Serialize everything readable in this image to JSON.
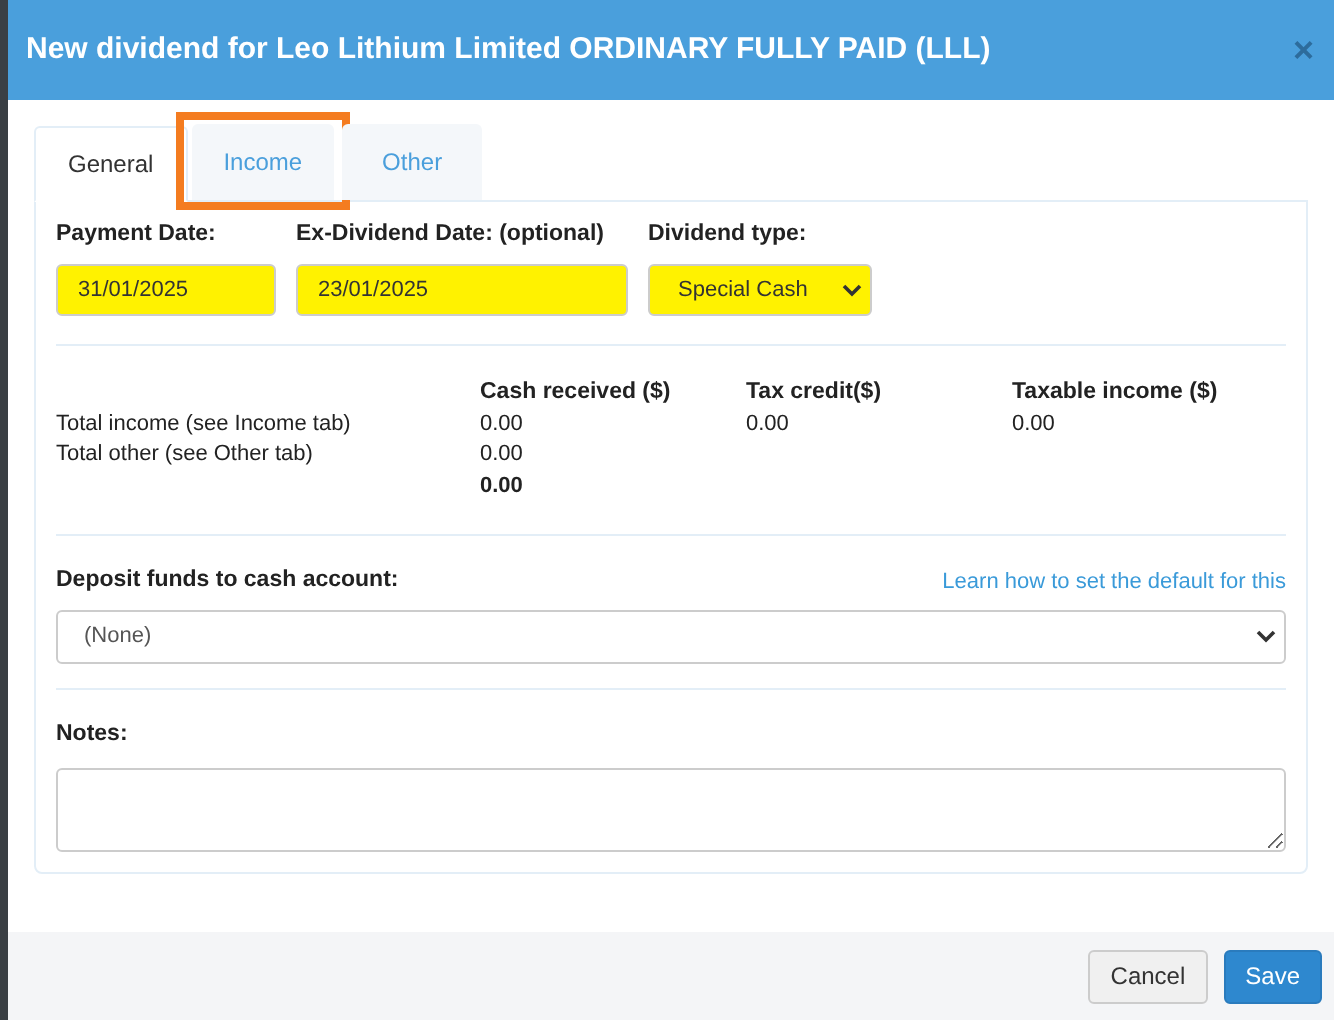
{
  "dialog": {
    "title": "New dividend for Leo Lithium Limited ORDINARY FULLY PAID (LLL)",
    "close": "×"
  },
  "tabs": [
    {
      "label": "General",
      "selected": true,
      "highlighted": false
    },
    {
      "label": "Income",
      "selected": false,
      "highlighted": true
    },
    {
      "label": "Other",
      "selected": false,
      "highlighted": false
    }
  ],
  "fields": [
    {
      "kind": "date",
      "label": "Payment Date:",
      "value": "31/01/2025"
    },
    {
      "kind": "date",
      "label": "Ex-Dividend Date: (optional)",
      "value": "23/01/2025"
    },
    {
      "kind": "select",
      "label": "Dividend type:",
      "value": "Special Cash"
    }
  ],
  "summary": {
    "columns": [
      "Cash received ($)",
      "Tax credit($)",
      "Taxable income ($)"
    ],
    "rows": [
      {
        "label": "Total income (see Income tab)",
        "cells": [
          "0.00",
          "0.00",
          "0.00"
        ]
      },
      {
        "label": "Total other (see Other tab)",
        "cells": [
          "0.00"
        ]
      }
    ],
    "total": "0.00"
  },
  "deposit": {
    "label": "Deposit funds to cash account:",
    "link": "Learn how to set the default for this",
    "value": "(None)"
  },
  "notes": {
    "label": "Notes:"
  },
  "buttons": [
    {
      "label": "Cancel",
      "kind": "secondary"
    },
    {
      "label": "Save",
      "kind": "primary"
    }
  ]
}
